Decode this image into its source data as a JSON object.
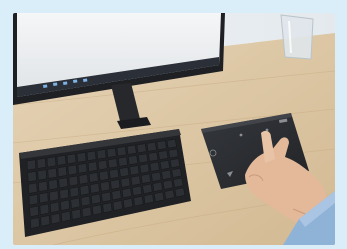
{
  "frame": {
    "background": "#d9eef8"
  },
  "scene": {
    "kind": "product-photo",
    "subject": "wireless-touchpad",
    "objects": [
      "monitor",
      "keyboard",
      "touchpad",
      "hand",
      "glass"
    ],
    "colors": {
      "desk": "#dcc8a8",
      "wall": "#eaeff2",
      "device": "#2b2d31",
      "sleeve": "#8fb2d7",
      "skin": "#e3b99a"
    }
  }
}
